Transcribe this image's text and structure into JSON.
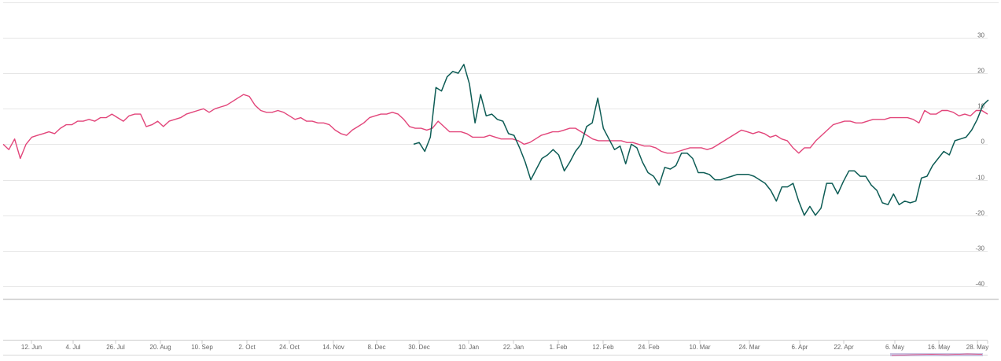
{
  "chart_data": {
    "type": "line",
    "title": "",
    "xlabel": "",
    "ylabel": "",
    "ylim": [
      -40,
      30
    ],
    "grid": true,
    "legend": "none",
    "y_ticks": [
      "30",
      "20",
      "10",
      "0",
      "-10",
      "-20",
      "-30",
      "-40"
    ],
    "x_ticks": [
      "12. Jun",
      "4. Jul",
      "26. Jul",
      "20. Aug",
      "10. Sep",
      "2. Oct",
      "24. Oct",
      "14. Nov",
      "8. Dec",
      "30. Dec",
      "10. Jan",
      "22. Jan",
      "1. Feb",
      "12. Feb",
      "24. Feb",
      "10. Mar",
      "24. Mar",
      "6. Apr",
      "22. Apr",
      "6. May",
      "16. May",
      "28. May"
    ],
    "series": [
      {
        "color": "#e2457a",
        "values": [
          0,
          -1.5,
          1.5,
          -4,
          0,
          2,
          2.5,
          3,
          3.5,
          3,
          4.5,
          5.5,
          5.5,
          6.5,
          6.5,
          7,
          6.5,
          7.5,
          7.5,
          8.5,
          7.5,
          6.5,
          8,
          8.5,
          8.5,
          5,
          5.5,
          6.5,
          5,
          6.5,
          7,
          7.5,
          8.5,
          9,
          9.5,
          10,
          9,
          10,
          10.5,
          11,
          12,
          13,
          14,
          13.5,
          11,
          9.5,
          9,
          9,
          9.5,
          9,
          8,
          7,
          7.5,
          6.5,
          6.5,
          6,
          6,
          5.5,
          4,
          3,
          2.5,
          4,
          5,
          6,
          7.5,
          8,
          8.5,
          8.5,
          9,
          8.5,
          7,
          5,
          4.5,
          4.5,
          4,
          4.5,
          6.5,
          5,
          3.5,
          3.5,
          3.5,
          3,
          2,
          2,
          2,
          2.5,
          2,
          1.5,
          1.5,
          1.5,
          1,
          0,
          0.5,
          1.5,
          2.5,
          3,
          3.5,
          3.5,
          4,
          4.5,
          4.5,
          3.5,
          2.5,
          1.5,
          1,
          1,
          1,
          1,
          1,
          0.5,
          0.5,
          0,
          -0.5,
          -0.5,
          -1,
          -2,
          -2.5,
          -2.5,
          -2,
          -1.5,
          -1,
          -1,
          -1,
          -1.5,
          -1,
          0,
          1,
          2,
          3,
          4,
          3.5,
          3,
          3.5,
          3,
          2,
          2.5,
          1.5,
          1,
          -1,
          -2.5,
          -1,
          -1,
          1,
          2.5,
          4,
          5.5,
          6,
          6.5,
          6.5,
          6,
          6,
          6.5,
          7,
          7,
          7,
          7.5,
          7.5,
          7.5,
          7.5,
          7,
          6,
          9.5,
          8.5,
          8.5,
          9.5,
          9.5,
          9,
          8,
          8.5,
          8,
          9.5,
          9.5,
          8.5
        ]
      },
      {
        "color": "#0d5c55",
        "values": [
          0,
          0.5,
          -2,
          2,
          16,
          15,
          19,
          20.5,
          20,
          22.5,
          17,
          6,
          14,
          8,
          8.5,
          7,
          6.5,
          3,
          2.5,
          -1,
          -5,
          -10,
          -7,
          -4,
          -3,
          -1.5,
          -3,
          -7.5,
          -5,
          -2,
          0,
          5,
          6,
          13,
          4.5,
          1.5,
          -1.5,
          -0.5,
          -5.5,
          0,
          -1,
          -5,
          -8,
          -9,
          -11.5,
          -6.5,
          -7,
          -6,
          -2.5,
          -2.5,
          -4,
          -8,
          -8,
          -8.5,
          -10,
          -10,
          -9.5,
          -9,
          -8.5,
          -8.5,
          -8.5,
          -9,
          -10,
          -11,
          -13,
          -16,
          -12,
          -12,
          -11,
          -16,
          -20,
          -17.5,
          -20,
          -18,
          -11,
          -11,
          -14,
          -10.5,
          -7.5,
          -7.5,
          -9,
          -9,
          -11.5,
          -13,
          -16.5,
          -17,
          -14,
          -17,
          -16,
          -16.5,
          -16,
          -9.5,
          -9,
          -6,
          -4,
          -2,
          -3,
          1,
          1.5,
          2,
          4,
          7,
          11,
          12.5
        ]
      }
    ]
  }
}
